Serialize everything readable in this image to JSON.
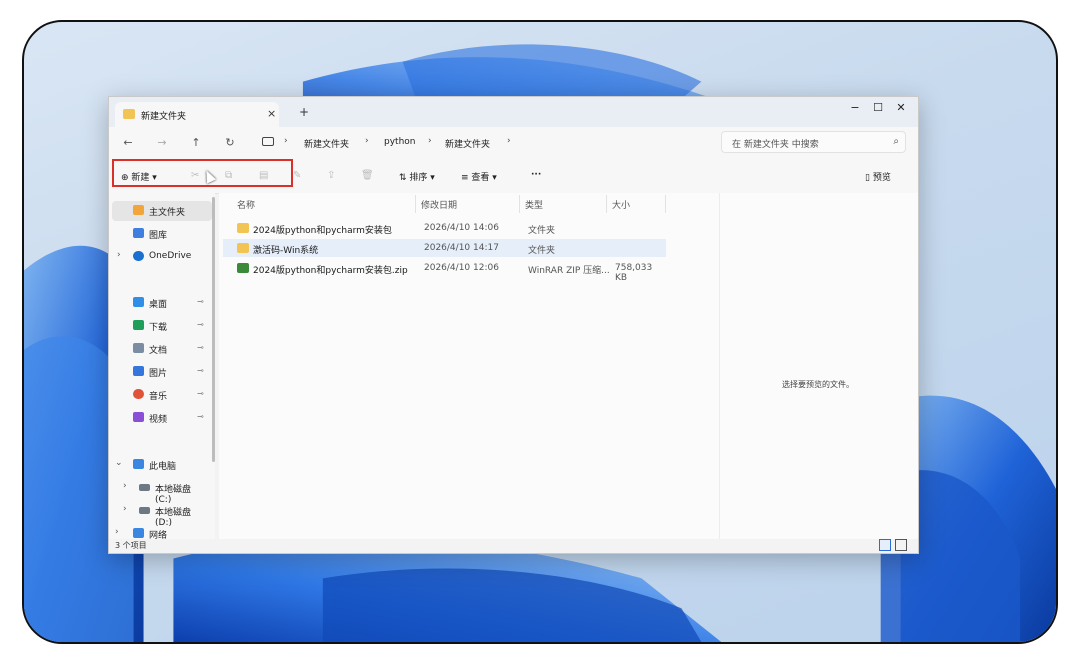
{
  "window": {
    "tab_title": "新建文件夹",
    "tab_close": "×",
    "new_tab": "+",
    "controls": {
      "minimize": "−",
      "maximize": "☐",
      "close": "✕"
    }
  },
  "nav": {
    "back": "←",
    "forward": "→",
    "up": "↑",
    "refresh": "↻",
    "breadcrumb": [
      "新建文件夹",
      "python",
      "新建文件夹"
    ],
    "separator": "›",
    "search_placeholder": "在 新建文件夹 中搜索",
    "search_icon": "⌕"
  },
  "toolbar": {
    "new_label": "新建",
    "sort_label": "排序",
    "view_label": "查看",
    "more_label": "···",
    "preview_label": "预览"
  },
  "sidebar": {
    "home": "主文件夹",
    "gallery": "图库",
    "onedrive": "OneDrive",
    "quick": [
      "桌面",
      "下载",
      "文档",
      "图片",
      "音乐",
      "视频"
    ],
    "pin_glyph": "📌",
    "this_pc": "此电脑",
    "drives": [
      "本地磁盘 (C:)",
      "本地磁盘 (D:)"
    ],
    "network": "网络"
  },
  "columns": {
    "name": "名称",
    "date": "修改日期",
    "type": "类型",
    "size": "大小"
  },
  "files": [
    {
      "name": "2024版python和pycharm安装包",
      "date": "2026/4/10 14:06",
      "type": "文件夹",
      "size": ""
    },
    {
      "name": "激活码-Win系统",
      "date": "2026/4/10 14:17",
      "type": "文件夹",
      "size": ""
    },
    {
      "name": "2024版python和pycharm安装包.zip",
      "date": "2026/4/10 12:06",
      "type": "WinRAR ZIP 压缩...",
      "size": "758,033 KB"
    }
  ],
  "preview": {
    "message": "选择要预览的文件。"
  },
  "status": {
    "item_count": "3 个项目"
  },
  "colors": {
    "folder": "#f1c453",
    "accent": "#2a6bd8",
    "highlight": "#d9302a"
  }
}
